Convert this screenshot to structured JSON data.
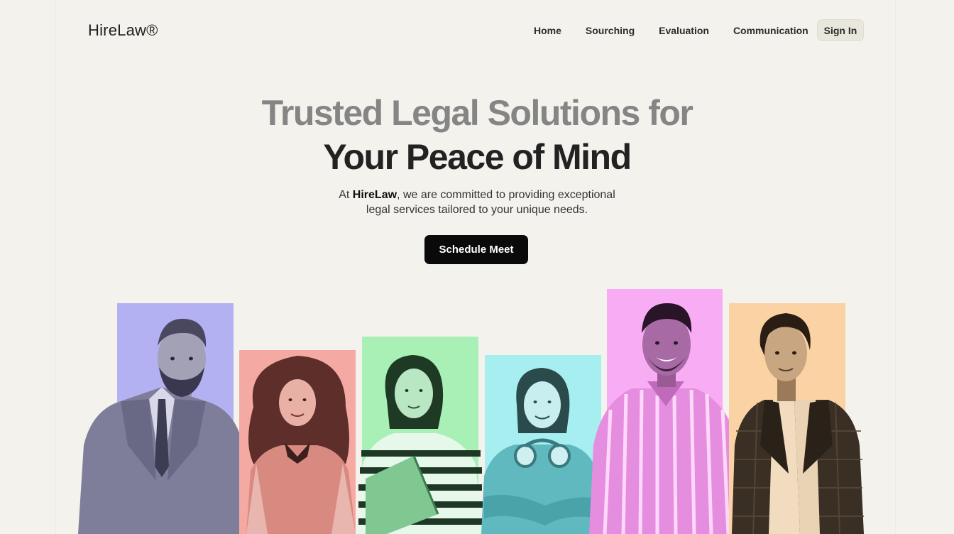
{
  "nav": {
    "logo": "HireLaw®",
    "links": [
      "Home",
      "Sourching",
      "Evaluation",
      "Communication"
    ],
    "sign_in": "Sign In"
  },
  "hero": {
    "title_line1": "Trusted Legal Solutions for",
    "title_line2": "Your Peace of Mind",
    "subtitle_prefix": "At ",
    "subtitle_brand": "HireLaw",
    "subtitle_rest": ", we are committed to providing exceptional",
    "subtitle_line2": "legal services tailored to your unique needs.",
    "cta": "Schedule Meet"
  },
  "team": {
    "colors": {
      "lavender": "#b3b1f2",
      "salmon": "#f4aaa3",
      "mint": "#a8f0b6",
      "aqua": "#a6eef0",
      "pink": "#f8acf4",
      "peach": "#fbd2a4"
    },
    "members": [
      {
        "icon": "bearded-man-in-suit-photo",
        "color": "lavender"
      },
      {
        "icon": "curly-haired-woman-photo",
        "color": "salmon"
      },
      {
        "icon": "woman-with-folder-photo",
        "color": "mint"
      },
      {
        "icon": "woman-with-headphones-photo",
        "color": "aqua"
      },
      {
        "icon": "smiling-man-striped-shirt-photo",
        "color": "pink"
      },
      {
        "icon": "man-in-plaid-blazer-photo",
        "color": "peach"
      }
    ]
  }
}
